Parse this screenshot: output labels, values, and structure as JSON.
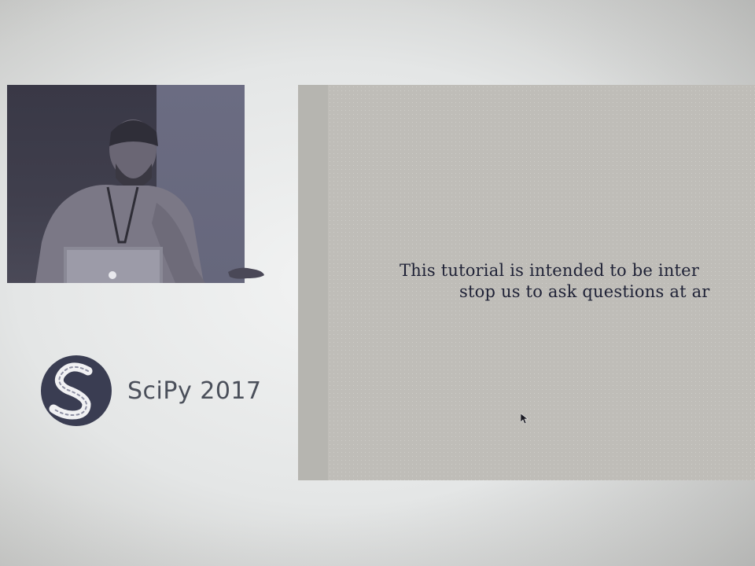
{
  "brand": {
    "logo_icon": "scipy-logo-icon",
    "name": "SciPy 2017"
  },
  "speaker_video": {
    "icon": "speaker-video-feed"
  },
  "slide": {
    "lines": [
      "This tutorial is intended to be inter",
      "stop us to ask questions at ar"
    ]
  },
  "colors": {
    "background": "#e4e6e6",
    "slide_background": "#bdbbb6",
    "slide_text": "#1f2236",
    "brand_text": "#4a4f5a",
    "logo_dark": "#3a3d52",
    "logo_light": "#f1f1f3",
    "video_dark": "#393846",
    "video_right": "#6b6c82"
  }
}
